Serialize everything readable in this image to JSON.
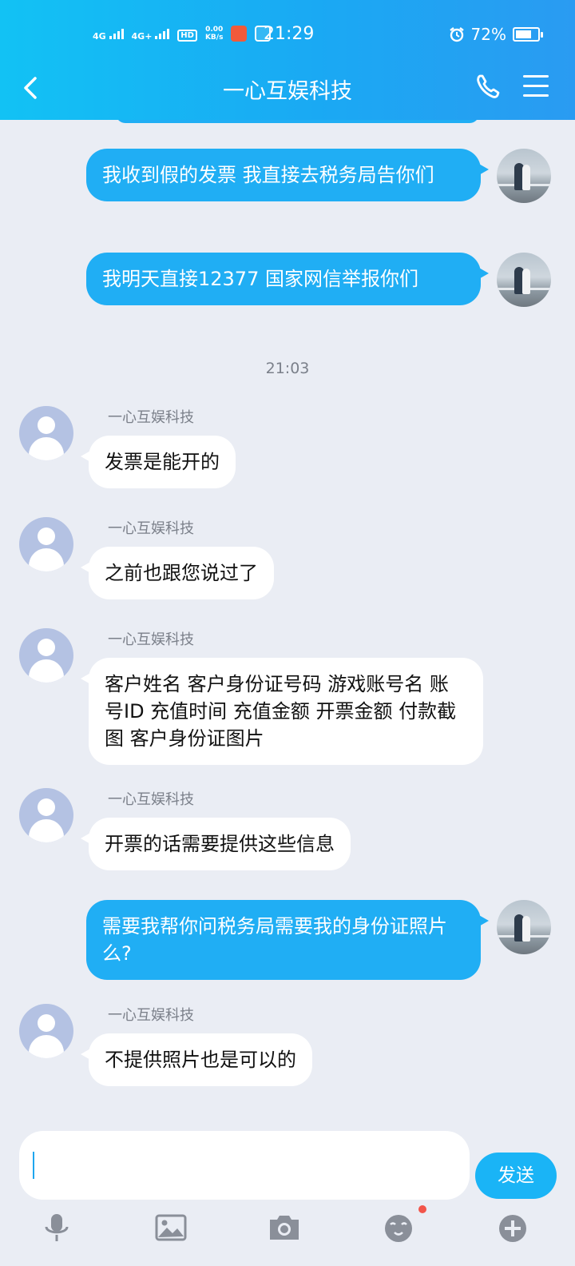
{
  "status_bar": {
    "network1": "4G",
    "network2": "4G+",
    "hd": "HD",
    "speed_value": "0.00",
    "speed_unit": "KB/s",
    "time": "21:29",
    "battery": "72%",
    "battery_level": 0.72
  },
  "header": {
    "title": "一心互娱科技"
  },
  "messages": [
    {
      "side": "me",
      "text": "我收到假的发票 我直接去税务局告你们"
    },
    {
      "side": "me",
      "text": "我明天直接12377 国家网信举报你们"
    },
    {
      "type": "time",
      "text": "21:03"
    },
    {
      "side": "other",
      "sender": "一心互娱科技",
      "text": "发票是能开的"
    },
    {
      "side": "other",
      "sender": "一心互娱科技",
      "text": "之前也跟您说过了"
    },
    {
      "side": "other",
      "sender": "一心互娱科技",
      "text": "客户姓名 客户身份证号码 游戏账号名 账号ID 充值时间 充值金额 开票金额 付款截图 客户身份证图片"
    },
    {
      "side": "other",
      "sender": "一心互娱科技",
      "text": "开票的话需要提供这些信息"
    },
    {
      "side": "me",
      "text": "需要我帮你问税务局需要我的身份证照片么?"
    },
    {
      "side": "other",
      "sender": "一心互娱科技",
      "text": "不提供照片也是可以的"
    }
  ],
  "input": {
    "value": "",
    "send_label": "发送"
  },
  "toolbar": {
    "items": [
      "mic-icon",
      "image-icon",
      "camera-icon",
      "emoji-icon",
      "plus-icon"
    ],
    "emoji_badge": true
  },
  "colors": {
    "header_start": "#12c2f4",
    "header_end": "#2a9bf2",
    "my_bubble": "#20aef4",
    "background": "#eaedf4",
    "send_button": "#1ab4f6"
  }
}
